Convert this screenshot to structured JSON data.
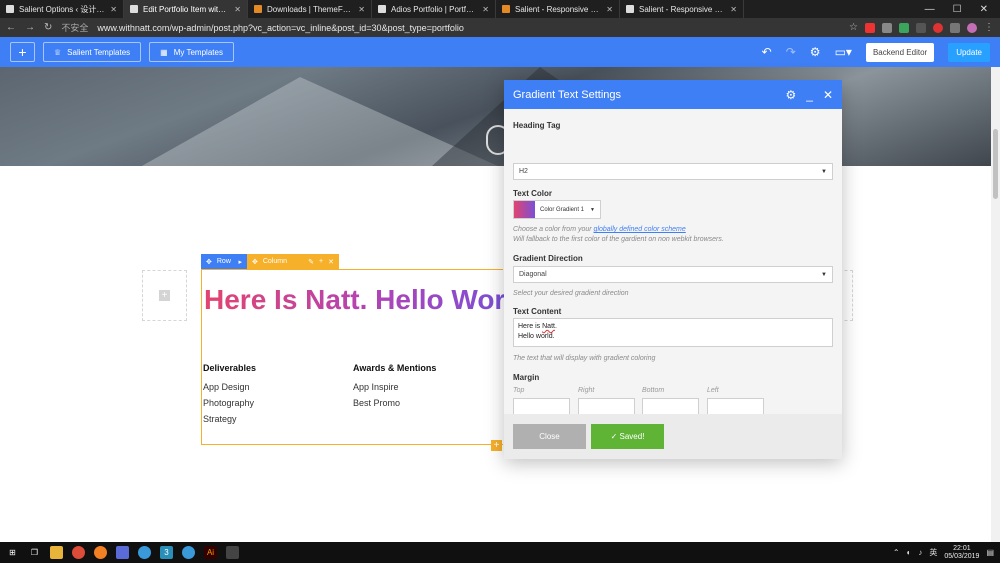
{
  "browser": {
    "tabs": [
      {
        "title": "Salient Options ‹ 设计师零代码…",
        "active": false
      },
      {
        "title": "Edit Portfolio Item with WPBaker…",
        "active": true
      },
      {
        "title": "Downloads | ThemeForest",
        "active": false
      },
      {
        "title": "Adios Portfolio | Portfolio WordP…",
        "active": false
      },
      {
        "title": "Salient - Responsive Multi-Purp…",
        "active": false
      },
      {
        "title": "Salient - Responsive Multi-Purp…",
        "active": false
      }
    ],
    "insecure_label": "不安全",
    "url": "www.withnatt.com/wp-admin/post.php?vc_action=vc_inline&post_id=30&post_type=portfolio"
  },
  "toolbar": {
    "add_label": "+",
    "salient_templates": "Salient Templates",
    "my_templates": "My Templates",
    "backend_editor": "Backend Editor",
    "update": "Update"
  },
  "builder": {
    "row_label": "Row",
    "column_label": "Column"
  },
  "content": {
    "heading": "Here Is Natt. Hello World.",
    "gradient_colors": [
      "#e2446f",
      "#b343b4",
      "#7b4fd6"
    ],
    "deliverables_title": "Deliverables",
    "deliverables": [
      "App Design",
      "Photography",
      "Strategy"
    ],
    "awards_title": "Awards & Mentions",
    "awards": [
      "App Inspire",
      "Best Promo"
    ]
  },
  "modal": {
    "title": "Gradient Text Settings",
    "heading_tag_label": "Heading Tag",
    "heading_tag_value": "H2",
    "text_color_label": "Text Color",
    "text_color_value": "Color Gradient 1",
    "text_color_hint_prefix": "Choose a color from your ",
    "text_color_hint_link": "globally defined color scheme",
    "text_color_hint_suffix": "Will fallback to the first color of the gardient on non webkit browsers.",
    "gradient_direction_label": "Gradient Direction",
    "gradient_direction_value": "Diagonal",
    "gradient_direction_hint": "Select your desired gradient direction",
    "text_content_label": "Text Content",
    "text_content_line1_a": "Here is ",
    "text_content_line1_b": "Natt",
    "text_content_line1_c": ".",
    "text_content_line2": "Hello world.",
    "text_content_hint": "The text that will display with gradient coloring",
    "margin_label": "Margin",
    "margin_top": "Top",
    "margin_right": "Right",
    "margin_bottom": "Bottom",
    "margin_left": "Left",
    "close_label": "Close",
    "saved_label": "✓ Saved!"
  },
  "taskbar": {
    "ime": "英",
    "time": "22:01",
    "date": "05/03/2019"
  },
  "colors": {
    "accent": "#3e7ff5",
    "column": "#f7b02a",
    "saved": "#5fb335"
  }
}
